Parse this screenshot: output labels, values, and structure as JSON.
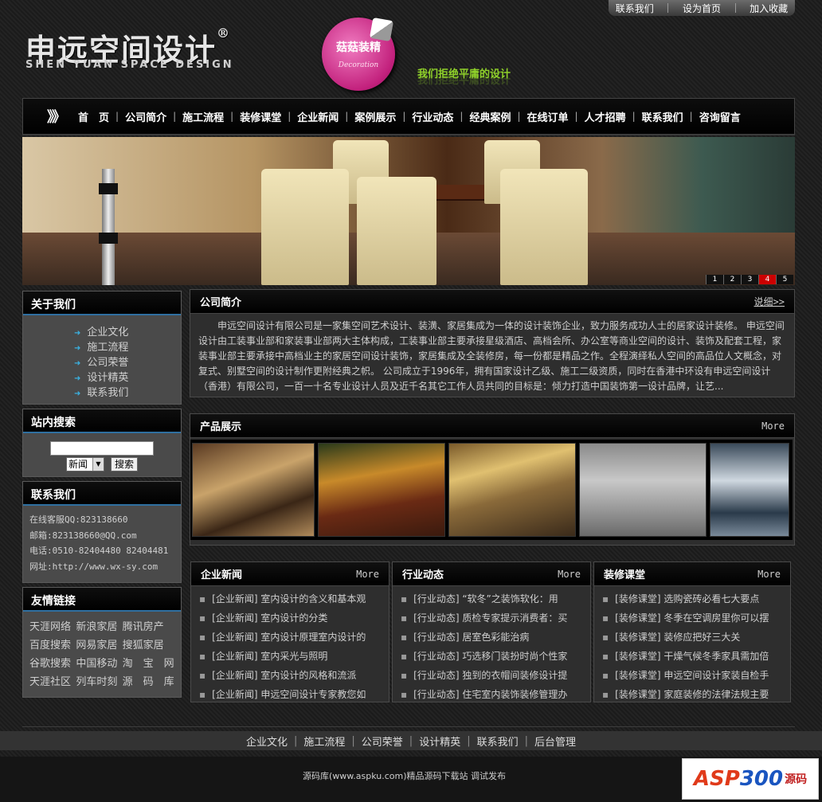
{
  "top_links": [
    "联系我们",
    "设为首页",
    "加入收藏"
  ],
  "logo": {
    "cn": "申远空间设计",
    "reg": "®",
    "en": "SHEN YUAN SPACE DESIGN",
    "sticker_cn": "菇菇装精",
    "sticker_en": "Decoration"
  },
  "slogan": "我们拒绝平庸的设计",
  "nav": {
    "arrows": "》》",
    "items": [
      "首　页",
      "公司简介",
      "施工流程",
      "装修课堂",
      "企业新闻",
      "案例展示",
      "行业动态",
      "经典案例",
      "在线订单",
      "人才招聘",
      "联系我们",
      "咨询留言"
    ]
  },
  "banner": {
    "pager": [
      "1",
      "2",
      "3",
      "4",
      "5"
    ],
    "active_page": "4"
  },
  "about": {
    "title": "关于我们",
    "items": [
      "企业文化",
      "施工流程",
      "公司荣誉",
      "设计精英",
      "联系我们"
    ]
  },
  "search": {
    "title": "站内搜索",
    "select_value": "新闻",
    "button": "搜索"
  },
  "contact": {
    "title": "联系我们",
    "lines": [
      "在线客服QQ:823138660",
      "邮箱:823138660@QQ.com",
      "电话:0510-82404480 82404481",
      "网址:http://www.wx-sy.com"
    ]
  },
  "links": {
    "title": "友情链接",
    "items": [
      "天涯网络",
      "新浪家居",
      "腾讯房产",
      "百度搜索",
      "网易家居",
      "搜狐家居",
      "谷歌搜索",
      "中国移动",
      "淘　宝　网",
      "天涯社区",
      "列车时刻",
      "源　码　库"
    ]
  },
  "intro": {
    "title": "公司简介",
    "more": "说细>>",
    "text": "申远空间设计有限公司是一家集空间艺术设计、装潢、家居集成为一体的设计装饰企业，致力服务成功人士的居家设计装修。 申远空间设计由工装事业部和家装事业部两大主体构成，工装事业部主要承接星级酒店、高档会所、办公室等商业空间的设计、装饰及配套工程，家装事业部主要承接中高档业主的家居空间设计装饰，家居集成及全装修房，每一份都是精品之作。全程演绎私人空间的高品位人文概念，对复式、别墅空间的设计制作更附经典之帜。 公司成立于1996年，拥有国家设计乙级、施工二级资质，同时在香港中环设有申远空间设计（香港）有限公司，一百一十名专业设计人员及近千名其它工作人员共同的目标是：倾力打造中国装饰第一设计品牌，让艺..."
  },
  "products": {
    "title": "产品展示",
    "more": "More"
  },
  "news_panels": [
    {
      "title": "企业新闻",
      "more": "More",
      "items": [
        "[企业新闻] 室内设计的含义和基本观",
        "[企业新闻] 室内设计的分类",
        "[企业新闻] 室内设计原理室内设计的",
        "[企业新闻] 室内采光与照明",
        "[企业新闻] 室内设计的风格和流派",
        "[企业新闻] 申远空间设计专家教您如"
      ]
    },
    {
      "title": "行业动态",
      "more": "More",
      "items": [
        "[行业动态] “软冬”之装饰软化：用",
        "[行业动态] 质检专家提示消费者：买",
        "[行业动态] 居室色彩能治病",
        "[行业动态] 巧选移门装扮时尚个性家",
        "[行业动态] 独到的衣帽间装修设计提",
        "[行业动态] 住宅室内装饰装修管理办"
      ]
    },
    {
      "title": "装修课堂",
      "more": "More",
      "items": [
        "[装修课堂] 选购瓷砖必看七大要点",
        "[装修课堂] 冬季在空调房里你可以摆",
        "[装修课堂] 装修应把好三大关",
        "[装修课堂] 干燥气候冬季家具需加倍",
        "[装修课堂] 申远空间设计家装自检手",
        "[装修课堂] 家庭装修的法律法规主要"
      ]
    }
  ],
  "footer": {
    "links": [
      "企业文化",
      "施工流程",
      "公司荣誉",
      "设计精英",
      "联系我们",
      "后台管理"
    ],
    "copyright": "源码库(www.aspku.com)精品源码下载站 调试发布",
    "badge_a": "ASP",
    "badge_b": "300",
    "badge_c": "源码"
  }
}
